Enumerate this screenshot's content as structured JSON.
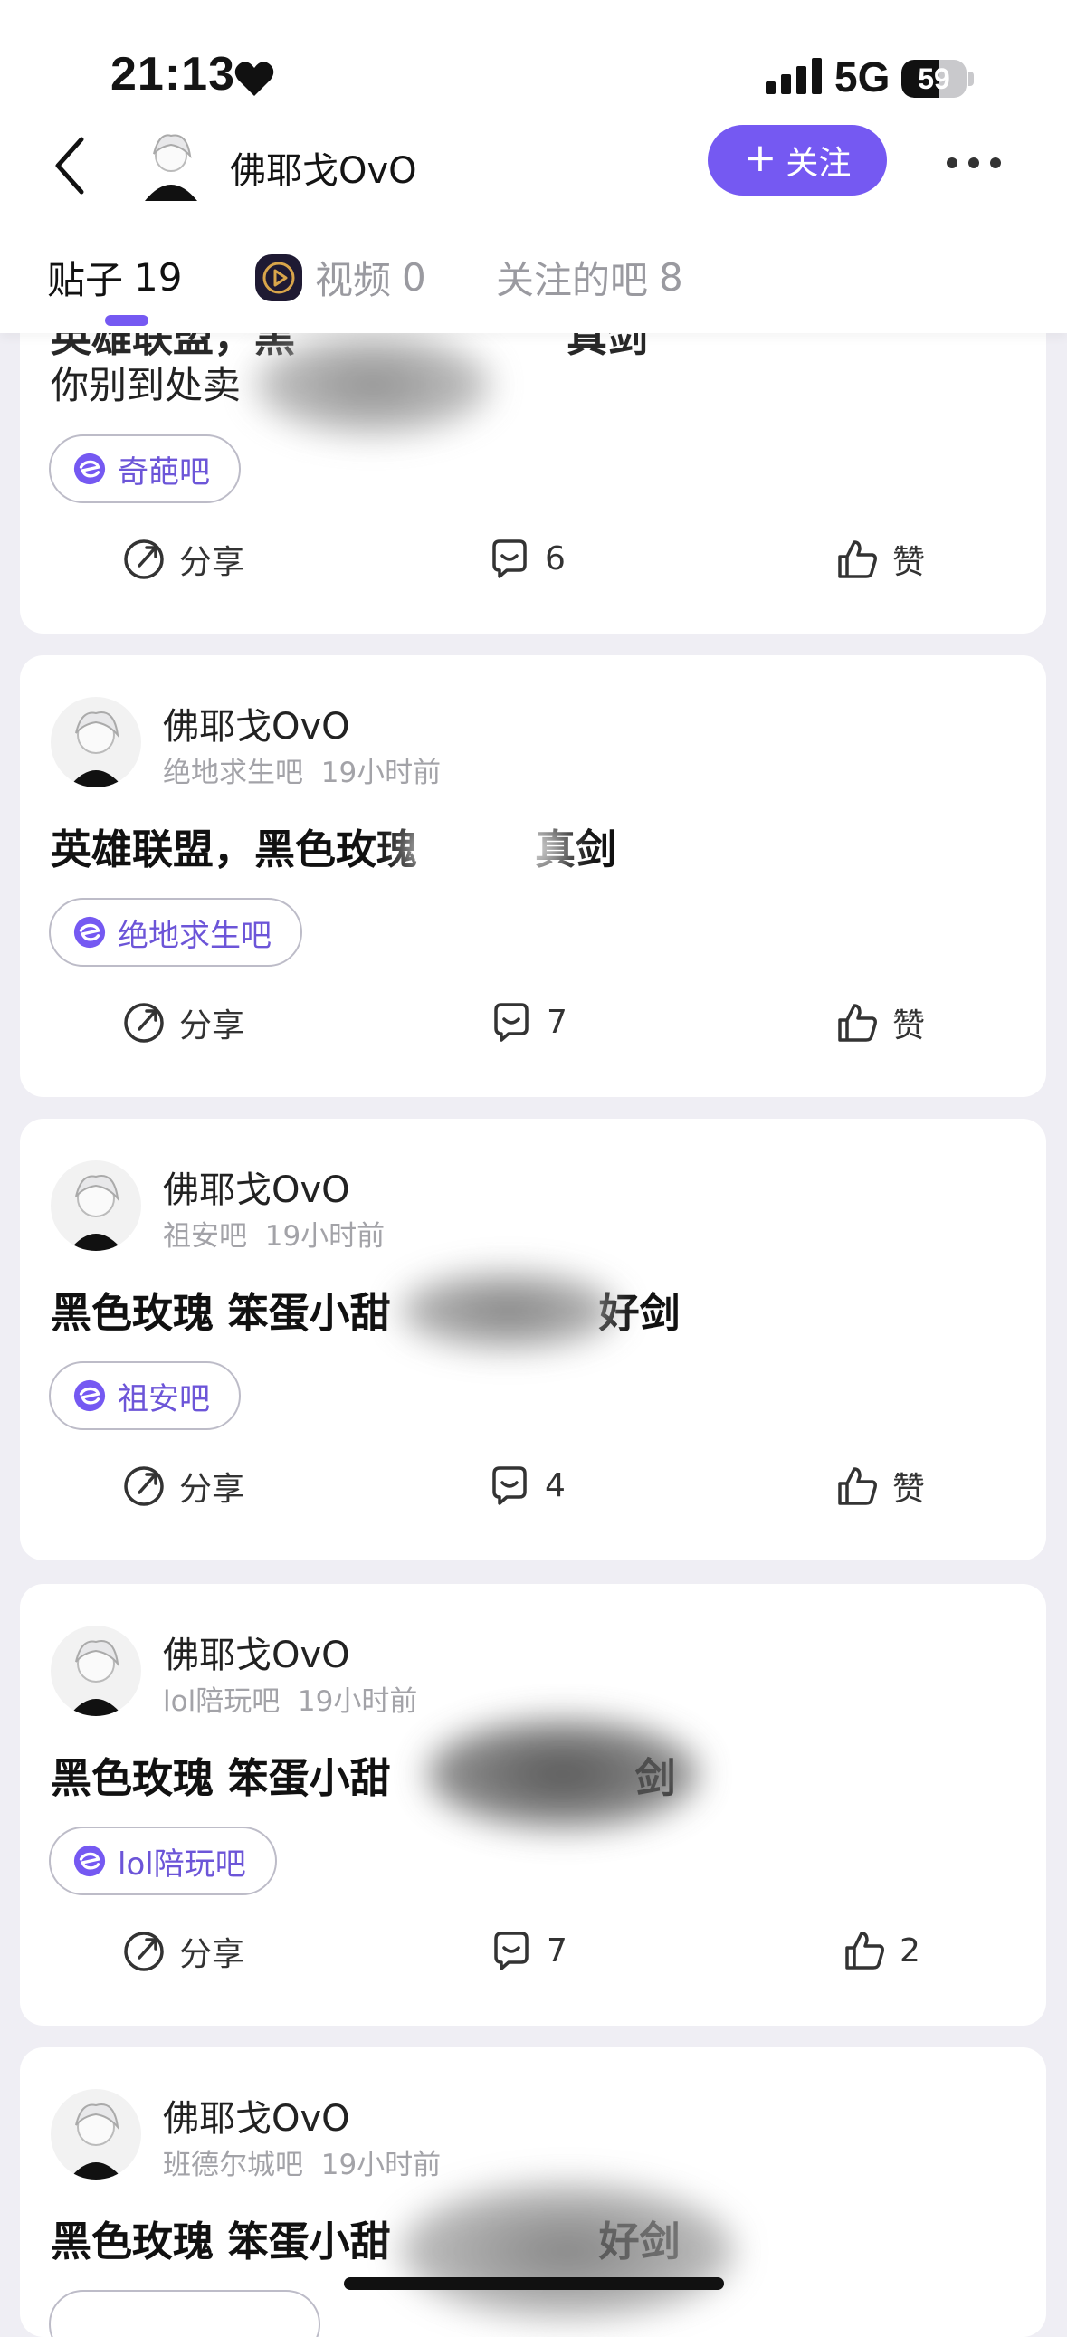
{
  "status_bar": {
    "time": "21:13",
    "network": "5G",
    "battery": "59",
    "battery_level": 0.59
  },
  "header": {
    "username": "佛耶戈OvO",
    "follow_label": "关注",
    "follow_plus": "+"
  },
  "tabs": [
    {
      "label": "贴子",
      "count": "19"
    },
    {
      "label": "视频",
      "count": "0"
    },
    {
      "label": "关注的吧",
      "count": "8"
    }
  ],
  "share_label": "分享",
  "like_label": "赞",
  "posts": [
    {
      "title_partial": "英雄联盟，黑",
      "title_partial_end": "真剑",
      "body": "你别到处卖",
      "forum": "奇葩吧",
      "comments": "6",
      "likes": "赞"
    },
    {
      "author": "佛耶戈OvO",
      "forum_meta": "绝地求生吧",
      "time": "19小时前",
      "title_start": "英雄联盟，黑色玫瑰",
      "title_end": "真剑",
      "forum": "绝地求生吧",
      "comments": "7",
      "likes": "赞"
    },
    {
      "author": "佛耶戈OvO",
      "forum_meta": "祖安吧",
      "time": "19小时前",
      "title_start": "黑色玫瑰 笨蛋小甜",
      "title_end": "好剑",
      "forum": "祖安吧",
      "comments": "4",
      "likes": "赞"
    },
    {
      "author": "佛耶戈OvO",
      "forum_meta": "lol陪玩吧",
      "time": "19小时前",
      "title_start": "黑色玫瑰 笨蛋小甜",
      "title_end": "剑",
      "forum": "lol陪玩吧",
      "comments": "7",
      "likes": "2"
    },
    {
      "author": "佛耶戈OvO",
      "forum_meta": "班德尔城吧",
      "time": "19小时前",
      "title_start": "黑色玫瑰 笨蛋小甜",
      "title_end": "好剑"
    }
  ],
  "colors": {
    "accent": "#7559f2",
    "background": "#efeef4"
  }
}
